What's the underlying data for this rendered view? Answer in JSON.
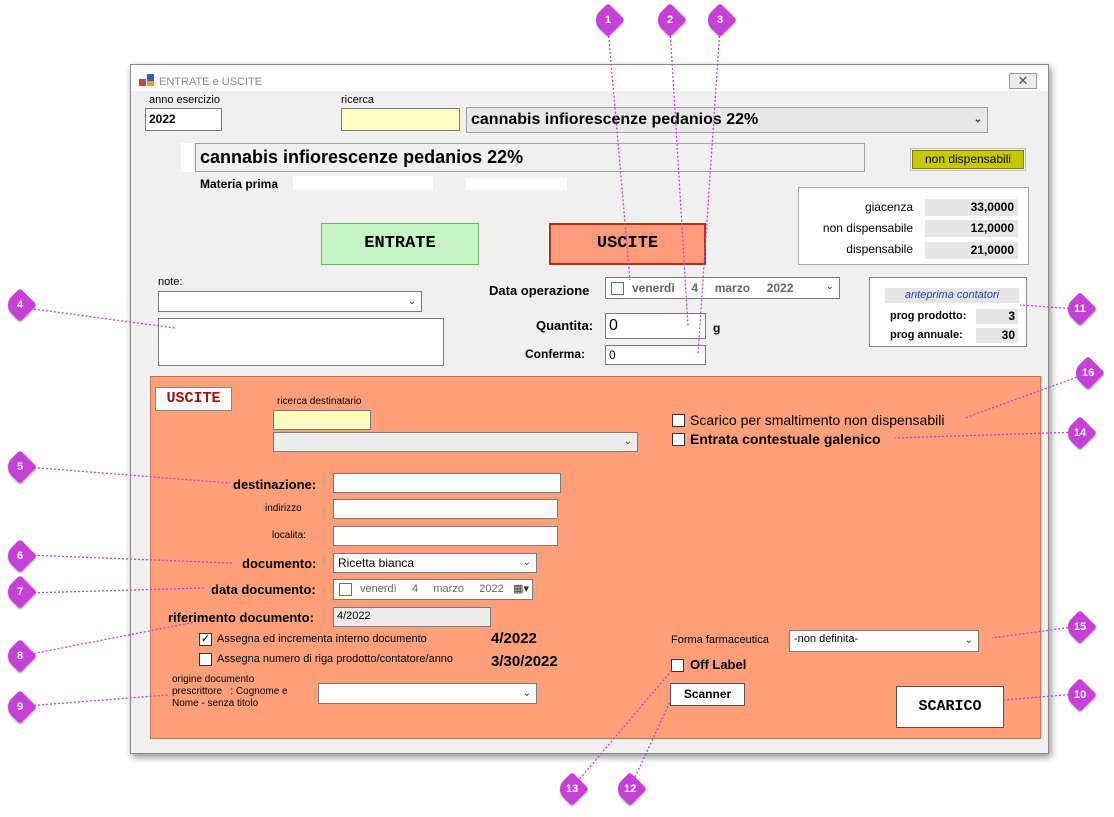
{
  "window": {
    "title": "ENTRATE e USCITE",
    "close_glyph": "✕"
  },
  "header": {
    "anno_label": "anno esercizio",
    "anno_value": "2022",
    "ricerca_label": "ricerca",
    "ricerca_value": "",
    "product_selected": "cannabis infiorescenze pedanios 22%",
    "product_title": "cannabis infiorescenze pedanios 22%",
    "materia_label": "Materia prima",
    "nondisp_badge": "non dispensabili"
  },
  "stock": {
    "giacenza_label": "giacenza",
    "giacenza_value": "33,0000",
    "nondisp_label": "non dispensabile",
    "nondisp_value": "12,0000",
    "disp_label": "dispensabile",
    "disp_value": "21,0000"
  },
  "mode_buttons": {
    "entrate": "ENTRATE",
    "uscite": "USCITE"
  },
  "note": {
    "label": "note:",
    "select_value": "",
    "text_value": ""
  },
  "operation": {
    "date_label": "Data operazione",
    "date_value": "venerdì     4     marzo     2022",
    "qty_label": "Quantita:",
    "qty_value": "0",
    "qty_unit": "g",
    "confirm_label": "Conferma:",
    "confirm_value": "0"
  },
  "counters": {
    "header": "anteprima contatori",
    "prog_prodotto_label": "prog prodotto:",
    "prog_prodotto_value": "3",
    "prog_annuale_label": "prog annuale:",
    "prog_annuale_value": "30"
  },
  "uscite": {
    "tag": "USCITE",
    "ricerca_dest_label": "ricerca destinatario",
    "ricerca_dest_value": "",
    "dest_combo_value": "",
    "scarico_smalt_label": "Scarico per smaltimento non dispensabili",
    "entrata_galenico_label": "Entrata contestuale galenico",
    "destinazione_label": "destinazione:",
    "destinazione_value": "",
    "indirizzo_label": "indirizzo",
    "indirizzo_value": "",
    "localita_label": "localita:",
    "localita_value": "",
    "documento_label": "documento:",
    "documento_value": "Ricetta bianca",
    "data_doc_label": "data documento:",
    "data_doc_value": "venerdì     4     marzo     2022",
    "rif_doc_label": "riferimento documento:",
    "rif_doc_value": "4/2022",
    "assegna_interno_label": "Assegna ed incrementa interno documento",
    "assegna_interno_value": "4/2022",
    "assegna_riga_label": "Assegna numero di riga prodotto/contatore/anno",
    "assegna_riga_value": "3/30/2022",
    "origine_label_1": "origine documento",
    "origine_label_2": "prescrittore   : Cognome e",
    "origine_label_3": "Nome - senza titolo",
    "origine_value": "",
    "forma_label": "Forma farmaceutica",
    "forma_value": "-non definita-",
    "off_label": "Off Label",
    "scanner": "Scanner",
    "scarico": "SCARICO"
  },
  "callouts": [
    "1",
    "2",
    "3",
    "4",
    "5",
    "6",
    "7",
    "8",
    "9",
    "10",
    "11",
    "12",
    "13",
    "14",
    "15",
    "16"
  ],
  "colors": {
    "callout": "#c640d8",
    "uscite_panel": "#ffa07a",
    "entrate_button": "#c6f5c6",
    "uscite_button": "#ff9a7a",
    "badge": "#c8c800",
    "yellow_field": "#ffffc4"
  }
}
